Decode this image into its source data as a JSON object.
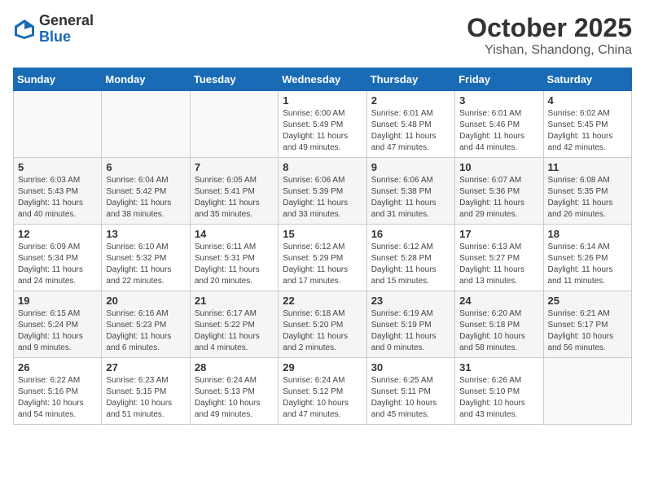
{
  "header": {
    "logo_general": "General",
    "logo_blue": "Blue",
    "month": "October 2025",
    "location": "Yishan, Shandong, China"
  },
  "weekdays": [
    "Sunday",
    "Monday",
    "Tuesday",
    "Wednesday",
    "Thursday",
    "Friday",
    "Saturday"
  ],
  "weeks": [
    [
      {
        "day": "",
        "info": ""
      },
      {
        "day": "",
        "info": ""
      },
      {
        "day": "",
        "info": ""
      },
      {
        "day": "1",
        "info": "Sunrise: 6:00 AM\nSunset: 5:49 PM\nDaylight: 11 hours\nand 49 minutes."
      },
      {
        "day": "2",
        "info": "Sunrise: 6:01 AM\nSunset: 5:48 PM\nDaylight: 11 hours\nand 47 minutes."
      },
      {
        "day": "3",
        "info": "Sunrise: 6:01 AM\nSunset: 5:46 PM\nDaylight: 11 hours\nand 44 minutes."
      },
      {
        "day": "4",
        "info": "Sunrise: 6:02 AM\nSunset: 5:45 PM\nDaylight: 11 hours\nand 42 minutes."
      }
    ],
    [
      {
        "day": "5",
        "info": "Sunrise: 6:03 AM\nSunset: 5:43 PM\nDaylight: 11 hours\nand 40 minutes."
      },
      {
        "day": "6",
        "info": "Sunrise: 6:04 AM\nSunset: 5:42 PM\nDaylight: 11 hours\nand 38 minutes."
      },
      {
        "day": "7",
        "info": "Sunrise: 6:05 AM\nSunset: 5:41 PM\nDaylight: 11 hours\nand 35 minutes."
      },
      {
        "day": "8",
        "info": "Sunrise: 6:06 AM\nSunset: 5:39 PM\nDaylight: 11 hours\nand 33 minutes."
      },
      {
        "day": "9",
        "info": "Sunrise: 6:06 AM\nSunset: 5:38 PM\nDaylight: 11 hours\nand 31 minutes."
      },
      {
        "day": "10",
        "info": "Sunrise: 6:07 AM\nSunset: 5:36 PM\nDaylight: 11 hours\nand 29 minutes."
      },
      {
        "day": "11",
        "info": "Sunrise: 6:08 AM\nSunset: 5:35 PM\nDaylight: 11 hours\nand 26 minutes."
      }
    ],
    [
      {
        "day": "12",
        "info": "Sunrise: 6:09 AM\nSunset: 5:34 PM\nDaylight: 11 hours\nand 24 minutes."
      },
      {
        "day": "13",
        "info": "Sunrise: 6:10 AM\nSunset: 5:32 PM\nDaylight: 11 hours\nand 22 minutes."
      },
      {
        "day": "14",
        "info": "Sunrise: 6:11 AM\nSunset: 5:31 PM\nDaylight: 11 hours\nand 20 minutes."
      },
      {
        "day": "15",
        "info": "Sunrise: 6:12 AM\nSunset: 5:29 PM\nDaylight: 11 hours\nand 17 minutes."
      },
      {
        "day": "16",
        "info": "Sunrise: 6:12 AM\nSunset: 5:28 PM\nDaylight: 11 hours\nand 15 minutes."
      },
      {
        "day": "17",
        "info": "Sunrise: 6:13 AM\nSunset: 5:27 PM\nDaylight: 11 hours\nand 13 minutes."
      },
      {
        "day": "18",
        "info": "Sunrise: 6:14 AM\nSunset: 5:26 PM\nDaylight: 11 hours\nand 11 minutes."
      }
    ],
    [
      {
        "day": "19",
        "info": "Sunrise: 6:15 AM\nSunset: 5:24 PM\nDaylight: 11 hours\nand 9 minutes."
      },
      {
        "day": "20",
        "info": "Sunrise: 6:16 AM\nSunset: 5:23 PM\nDaylight: 11 hours\nand 6 minutes."
      },
      {
        "day": "21",
        "info": "Sunrise: 6:17 AM\nSunset: 5:22 PM\nDaylight: 11 hours\nand 4 minutes."
      },
      {
        "day": "22",
        "info": "Sunrise: 6:18 AM\nSunset: 5:20 PM\nDaylight: 11 hours\nand 2 minutes."
      },
      {
        "day": "23",
        "info": "Sunrise: 6:19 AM\nSunset: 5:19 PM\nDaylight: 11 hours\nand 0 minutes."
      },
      {
        "day": "24",
        "info": "Sunrise: 6:20 AM\nSunset: 5:18 PM\nDaylight: 10 hours\nand 58 minutes."
      },
      {
        "day": "25",
        "info": "Sunrise: 6:21 AM\nSunset: 5:17 PM\nDaylight: 10 hours\nand 56 minutes."
      }
    ],
    [
      {
        "day": "26",
        "info": "Sunrise: 6:22 AM\nSunset: 5:16 PM\nDaylight: 10 hours\nand 54 minutes."
      },
      {
        "day": "27",
        "info": "Sunrise: 6:23 AM\nSunset: 5:15 PM\nDaylight: 10 hours\nand 51 minutes."
      },
      {
        "day": "28",
        "info": "Sunrise: 6:24 AM\nSunset: 5:13 PM\nDaylight: 10 hours\nand 49 minutes."
      },
      {
        "day": "29",
        "info": "Sunrise: 6:24 AM\nSunset: 5:12 PM\nDaylight: 10 hours\nand 47 minutes."
      },
      {
        "day": "30",
        "info": "Sunrise: 6:25 AM\nSunset: 5:11 PM\nDaylight: 10 hours\nand 45 minutes."
      },
      {
        "day": "31",
        "info": "Sunrise: 6:26 AM\nSunset: 5:10 PM\nDaylight: 10 hours\nand 43 minutes."
      },
      {
        "day": "",
        "info": ""
      }
    ]
  ]
}
